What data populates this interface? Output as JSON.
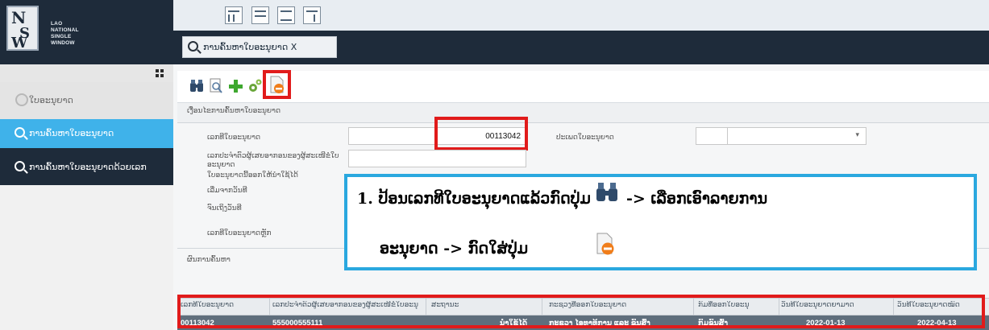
{
  "logo": {
    "mark_lines": [
      "N",
      "S",
      "W"
    ],
    "text_lines": [
      "LAO",
      "NATIONAL",
      "SINGLE",
      "WINDOW"
    ]
  },
  "sidebar": {
    "items": [
      {
        "label": "ໃບອະນຸຍາດ",
        "icon": "radio-icon"
      },
      {
        "label": "ການຄົ້ນຫາໃບອະນຸຍາດ",
        "icon": "search-icon",
        "active": true
      },
      {
        "label": "ການຄົ້ນຫາໃບອະນຸຍາດດ້ວຍເລກ",
        "icon": "search-icon"
      }
    ]
  },
  "tab": {
    "label": "ການຄົ້ນຫາໃບອະນຸຍາດ X"
  },
  "toolbar": {
    "icons": [
      "binoculars-icon",
      "preview-icon",
      "add-icon",
      "settings-icon",
      "remove-document-icon"
    ]
  },
  "search_form": {
    "header": "ເງື່ອນໄຂການຄົ້ນຫາໃບອະນຸຍາດ",
    "license_no_label": "ເລກທີໃບອະນຸຍາດ",
    "license_no_value": "00113042",
    "license_type_label": "ປະເພດໃບອະນຸຍາດ",
    "tax_id_label": "ເລກປະຈຳຕົວຜູ້ເສຍອາກອນຂອງຜູ້ສະເໜີຂໍໃບອະນຸຍາດ",
    "valid_label": "ໃບອະນຸຍາດນີ້ອອກໃຫ້ນຳໃຊ້ໄດ້",
    "start_label": "ເລີ່ມຈາກວັນທີ",
    "end_label": "ຈົນເຖິງວັນທີ",
    "main_license_label": "ເລກທີໃບອະນຸຍາດຫຼັກ"
  },
  "results": {
    "header": "ຜົນການຄົ້ນຫາ",
    "columns": [
      "ເລກທີໃບອະນຸຍາດ",
      "ເລກປະຈຳຕົວຜູ້ເສຍອາກອນຂອງຜູ້ສະເໜີຂໍໃບອະນຸ",
      "ສະຖານະ",
      "ກະຊວງທີ່ອອກໃບອະນຸຍາດ",
      "ກົມທີ່ອອກໃບອະນຸ",
      "ວັນທີໃບອະນຸຍາດຍາມາດ",
      "ວັນທີໃບອະນຸຍາດໝົດ"
    ],
    "rows": [
      [
        "00113042",
        "555000555111",
        "ນຳໃຊ້ໄດ້",
        "ກະຊວງ ໄອທາທິການ ແລະ ຂົນສົ່ງ",
        "ກົມຂົນສົ່ງ",
        "2022-01-13",
        "2022-04-13"
      ]
    ]
  },
  "callout": {
    "line1_prefix": "1.  ປ້ອນເລກທີໃບອະນຸຍາດແລ້ວກົດປຸ່ມ",
    "line1_suffix": "-> ເລືອກເອົາລາຍການ",
    "line2": "ອະນຸຍາດ -> ກົດໃສ່ປຸ່ມ"
  },
  "colors": {
    "sidebar_dark": "#1e2b3a",
    "sidebar_active": "#3fb2ea",
    "callout_border": "#2aa8df",
    "highlight": "#e11b1b",
    "row_selected": "#5f6e7c"
  }
}
